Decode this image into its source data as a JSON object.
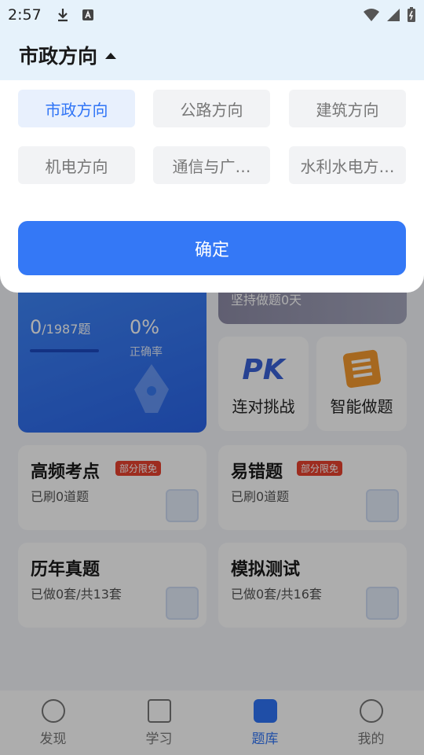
{
  "status_bar": {
    "time": "2:57",
    "left_icons": [
      "download-icon",
      "text-a-icon"
    ],
    "right_icons": [
      "wifi-icon",
      "signal-icon",
      "battery-icon"
    ]
  },
  "selector": {
    "title": "市政方向",
    "options": [
      "市政方向",
      "公路方向",
      "建筑方向",
      "机电方向",
      "通信与广…",
      "水利水电方…"
    ],
    "selected": "市政方向",
    "confirm_label": "确定"
  },
  "background": {
    "stats": {
      "done": "0",
      "total": "/1987题",
      "accuracy": "0%",
      "accuracy_label": "正确率"
    },
    "streak": "坚持做题0天",
    "quick": {
      "pk_logo": "PK",
      "pk_label": "连对挑战",
      "smart_label": "智能做题"
    },
    "features": [
      {
        "title": "高频考点",
        "badge": "部分限免",
        "sub": "已刷0道题"
      },
      {
        "title": "易错题",
        "badge": "部分限免",
        "sub": "已刷0道题"
      },
      {
        "title": "历年真题",
        "sub": "已做0套/共13套"
      },
      {
        "title": "模拟测试",
        "sub": "已做0套/共16套"
      }
    ]
  },
  "tabs": [
    {
      "label": "发现",
      "icon": "discover-icon"
    },
    {
      "label": "学习",
      "icon": "book-icon"
    },
    {
      "label": "题库",
      "icon": "question-bank-icon",
      "active": true
    },
    {
      "label": "我的",
      "icon": "profile-icon"
    }
  ],
  "colors": {
    "accent": "#3478f6",
    "badge": "#e8412f",
    "header_bg": "#e6f2fb"
  }
}
